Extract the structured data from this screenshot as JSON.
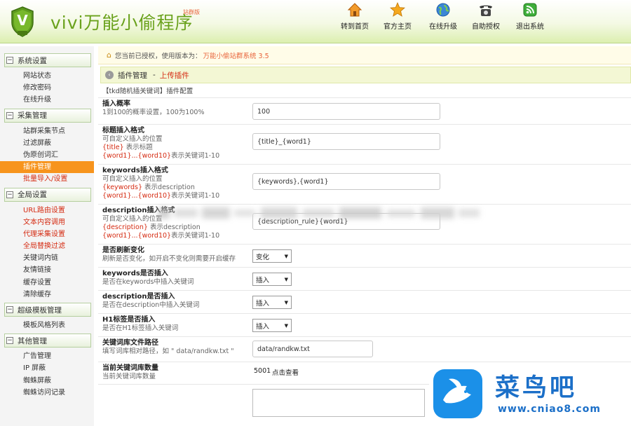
{
  "header": {
    "logo_text": "vivi万能小偷程序",
    "logo_badge": "站群版",
    "nav": [
      {
        "label": "转到首页",
        "icon": "home-icon"
      },
      {
        "label": "官方主页",
        "icon": "star-icon"
      },
      {
        "label": "在线升级",
        "icon": "globe-icon"
      },
      {
        "label": "自助授权",
        "icon": "telephone-icon"
      },
      {
        "label": "退出系统",
        "icon": "rss-icon"
      }
    ]
  },
  "sidebar": {
    "groups": [
      {
        "title": "系统设置",
        "items": [
          "网站状态",
          "修改密码",
          "在线升级"
        ]
      },
      {
        "title": "采集管理",
        "items": [
          "站群采集节点",
          "过滤屏蔽",
          "伪原创词汇",
          "插件管理",
          "批量导入/设置"
        ]
      },
      {
        "title": "全局设置",
        "items": [
          "URL路由设置",
          "文本内容调用",
          "代理采集设置",
          "全局替换过滤",
          "关键词内链",
          "友情链接",
          "缓存设置",
          "清除缓存"
        ]
      },
      {
        "title": "超级模板管理",
        "items": [
          "模板风格列表"
        ]
      },
      {
        "title": "其他管理",
        "items": [
          "广告管理",
          "IP 屏蔽",
          "蜘蛛屏蔽",
          "蜘蛛访问记录"
        ]
      }
    ],
    "active_item": "插件管理"
  },
  "main": {
    "notice_text": "您当前已授权，使用版本为：",
    "notice_version": "万能小偷站群系统 3.5",
    "crumb_parent": "插件管理",
    "crumb_sep": "-",
    "crumb_current": "上传插件",
    "plugin_title": "【tkd随机插关键词】插件配置",
    "fields": {
      "insert_prob": {
        "label": "插入概率",
        "desc": "1到100的概率设置，100为100%",
        "value": "100"
      },
      "title_format": {
        "label": "标题插入格式",
        "desc1": "可自定义插入的位置",
        "desc2_hl": "{title}",
        "desc2": " 表示标题",
        "desc3_hl": "{word1}...{word10}",
        "desc3": "表示关键词1-10",
        "value": "{title}_{word1}"
      },
      "keywords_format": {
        "label": "keywords插入格式",
        "desc1": "可自定义插入的位置",
        "desc2_hl": "{keywords}",
        "desc2": " 表示description",
        "desc3_hl": "{word1}...{word10}",
        "desc3": "表示关键词1-10",
        "value": "{keywords},{word1}"
      },
      "desc_format": {
        "label": "description插入格式",
        "desc1": "可自定义插入的位置",
        "desc2_hl": "{description}",
        "desc2": " 表示description",
        "desc3_hl": "{word1}...{word10}",
        "desc3": "表示关键词1-10",
        "value": "{description_rule}{word1}"
      },
      "refresh_change": {
        "label": "是否刷新变化",
        "desc": "刷新是否变化，如开启不变化则需要开启缓存",
        "value": "变化"
      },
      "keywords_insert": {
        "label": "keywords是否插入",
        "desc": "是否在keywords中插入关键词",
        "value": "插入"
      },
      "desc_insert": {
        "label": "description是否插入",
        "desc": "是否在description中插入关键词",
        "value": "插入"
      },
      "h1_insert": {
        "label": "H1标签是否插入",
        "desc": "是否在H1标签插入关键词",
        "value": "插入"
      },
      "kw_path": {
        "label": "关键词库文件路径",
        "desc": "填写词库相对路径，如 \" data/randkw.txt \"",
        "value": "data/randkw.txt"
      },
      "kw_count": {
        "label": "当前关键词库数量",
        "desc": "当前关键词库数量",
        "value": "5001",
        "link": "点击查看"
      }
    }
  },
  "watermark": {
    "title": "菜鸟吧",
    "url": "www.cniao8.com"
  },
  "colors": {
    "brand_green": "#6aa21c",
    "accent_orange": "#f7941d",
    "highlight_red": "#d52b12",
    "watermark_blue": "#1b90e8"
  }
}
